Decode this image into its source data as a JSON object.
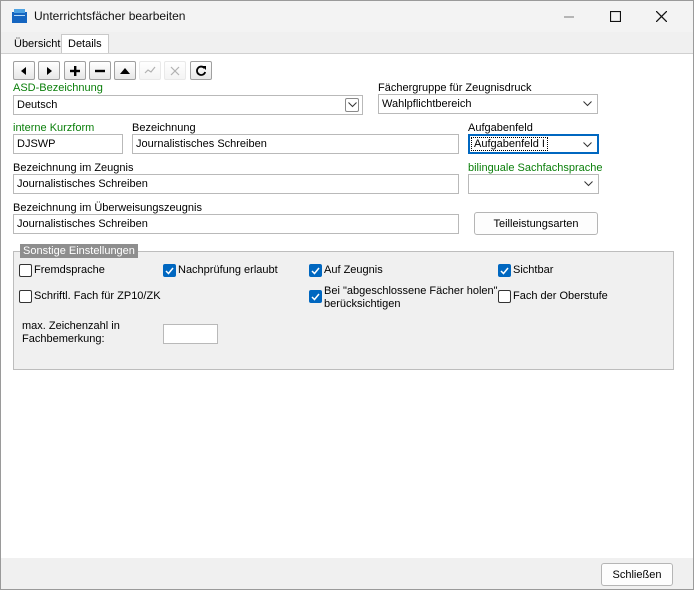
{
  "window": {
    "title": "Unterrichtsfächer bearbeiten",
    "accent": "#0067c0",
    "controls": [
      "minimize-icon",
      "maximize-icon",
      "close-icon"
    ]
  },
  "tabs": [
    {
      "label": "Übersicht",
      "selected": false
    },
    {
      "label": "Details",
      "selected": true
    }
  ],
  "toolbar": {
    "buttons": [
      {
        "icon": "arrow-left-icon",
        "enabled": true
      },
      {
        "icon": "arrow-right-icon",
        "enabled": true
      },
      {
        "icon": "plus-icon",
        "enabled": true
      },
      {
        "icon": "minus-icon",
        "enabled": true
      },
      {
        "icon": "arrow-up-icon",
        "enabled": true
      },
      {
        "icon": "check-icon",
        "enabled": false
      },
      {
        "icon": "cancel-icon",
        "enabled": false
      },
      {
        "icon": "refresh-icon",
        "enabled": true
      }
    ]
  },
  "form": {
    "asd": {
      "label": "ASD-Bezeichnung",
      "value": "Deutsch"
    },
    "faechergruppe": {
      "label": "Fächergruppe für Zeugnisdruck",
      "value": "Wahlpflichtbereich"
    },
    "kurzform": {
      "label": "interne Kurzform",
      "value": "DJSWP"
    },
    "bezeichnung": {
      "label": "Bezeichnung",
      "value": "Journalistisches Schreiben"
    },
    "aufgabenfeld": {
      "label": "Aufgabenfeld",
      "value": "Aufgabenfeld I"
    },
    "zeugnis": {
      "label": "Bezeichnung im Zeugnis",
      "value": "Journalistisches Schreiben"
    },
    "bilingual": {
      "label": "bilinguale Sachfachsprache",
      "value": ""
    },
    "ueberweisung": {
      "label": "Bezeichnung im Überweisungszeugnis",
      "value": "Journalistisches Schreiben"
    },
    "teilleistungen_button": "Teilleistungsarten"
  },
  "sonstige": {
    "title": "Sonstige Einstellungen",
    "checkboxes": [
      {
        "label": "Fremdsprache",
        "checked": false
      },
      {
        "label": "Nachprüfung erlaubt",
        "checked": true
      },
      {
        "label": "Auf Zeugnis",
        "checked": true
      },
      {
        "label": "Sichtbar",
        "checked": true
      },
      {
        "label": "Schriftl. Fach für ZP10/ZK",
        "checked": false
      },
      {
        "label_line1": "Bei \"abgeschlossene Fächer holen\"",
        "label_line2": "berücksichtigen",
        "checked": true
      },
      {
        "label": "Fach der Oberstufe",
        "checked": false
      }
    ],
    "max_label_line1": "max. Zeichenzahl in",
    "max_label_line2": "Fachbemerkung:",
    "max_value": ""
  },
  "footer": {
    "close_label": "Schließen"
  }
}
